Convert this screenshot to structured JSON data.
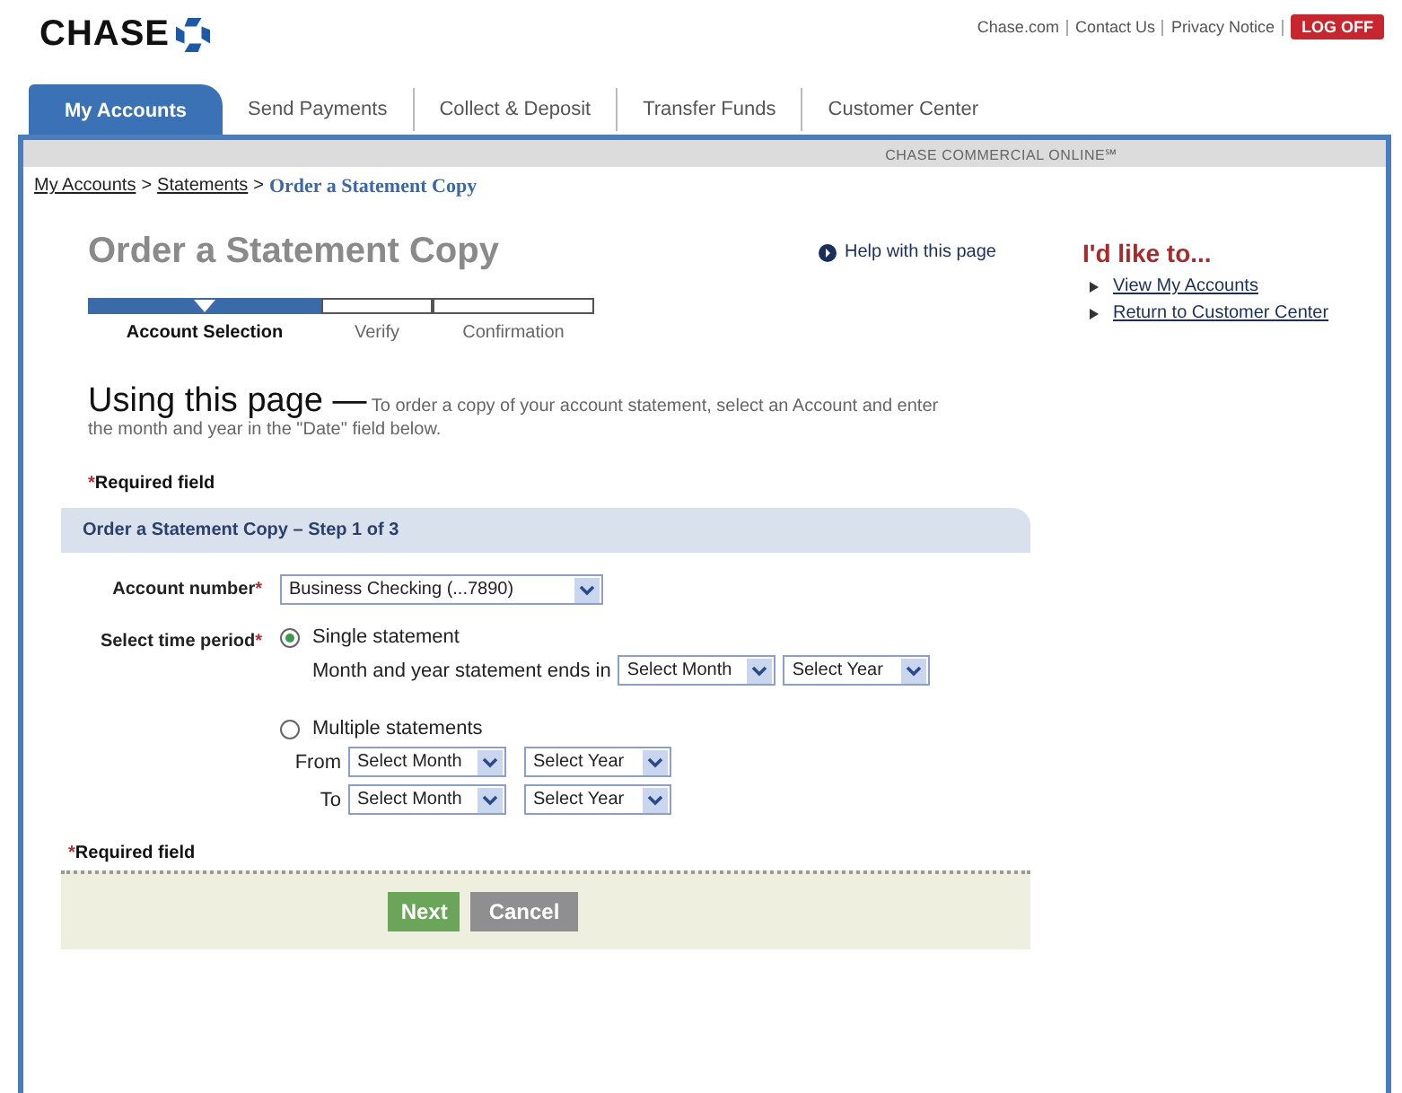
{
  "brand": {
    "name": "CHASE"
  },
  "top_links": [
    "Chase.com",
    "Contact Us",
    "Privacy Notice"
  ],
  "logoff_button": "LOG OFF",
  "tabs": [
    {
      "label": "My Accounts",
      "selected": true
    },
    {
      "label": "Send Payments",
      "selected": false
    },
    {
      "label": "Collect & Deposit",
      "selected": false
    },
    {
      "label": "Transfer Funds",
      "selected": false
    },
    {
      "label": "Customer Center",
      "selected": false
    }
  ],
  "product_banner": "CHASE COMMERCIAL ONLINE℠",
  "breadcrumb": [
    {
      "label": "My Accounts",
      "current": false
    },
    {
      "label": "Statements",
      "current": false
    },
    {
      "label": "Order a Statement Copy",
      "current": true
    }
  ],
  "breadcrumb_separator": ">",
  "page_title": "Order a Statement Copy",
  "help_link": "Help with this page",
  "steps": [
    {
      "label": "Account Selection",
      "selected": true
    },
    {
      "label": "Verify",
      "selected": false
    },
    {
      "label": "Confirmation",
      "selected": false
    }
  ],
  "intro": {
    "heading": "Using this page —",
    "text": "To order a copy of your account statement, select an Account and enter the month and year in the \"Date\" field below."
  },
  "required_note": {
    "mark": "*",
    "text": "Required field"
  },
  "section_title": "Order a Statement Copy – Step 1 of 3",
  "account": {
    "label": "Account number",
    "mark": "*",
    "value": "Business Checking (...7890)"
  },
  "time_period": {
    "label": "Select time period",
    "mark": "*",
    "options": [
      {
        "label": "Single statement",
        "selected": true,
        "rows": [
          {
            "label": "Month and year statement ends in",
            "selects": [
              "Select Month",
              "Select Year"
            ]
          }
        ]
      },
      {
        "label": "Multiple statements",
        "selected": false,
        "rows": [
          {
            "label": "From",
            "selects": [
              "Select Month",
              "Select Year"
            ]
          },
          {
            "label": "To",
            "selects": [
              "Select Month",
              "Select Year"
            ]
          }
        ]
      }
    ]
  },
  "required_note_bottom": {
    "mark": "*",
    "text": "Required field"
  },
  "buttons": [
    {
      "label": "Next",
      "kind": "primary"
    },
    {
      "label": "Cancel",
      "kind": "secondary"
    }
  ],
  "sidebar": {
    "heading": "I'd like to...",
    "links": [
      "View My Accounts",
      "Return to Customer Center"
    ]
  }
}
